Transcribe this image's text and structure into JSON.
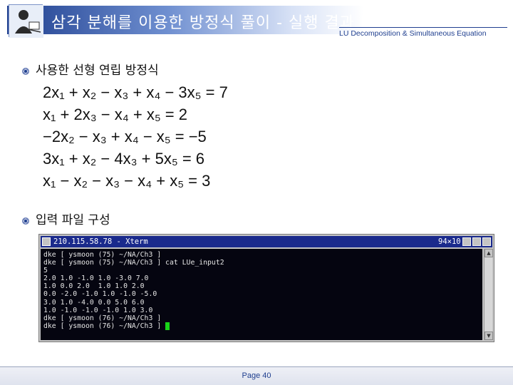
{
  "header": {
    "title": "삼각 분해를 이용한 방정식 풀이 - 실행 결과 II (1/2)",
    "subtitle": "LU Decomposition & Simultaneous Equation"
  },
  "bullets": [
    {
      "text": "사용한 선형 연립 방정식"
    },
    {
      "text": "입력 파일 구성"
    }
  ],
  "equations": [
    "2x₁ + x₂ − x₃ + x₄ − 3x₅ = 7",
    "x₁ + 2x₃ − x₄ + x₅ = 2",
    "−2x₂ − x₃ + x₄ − x₅ = −5",
    "3x₁ + x₂ − 4x₃ + 5x₅ = 6",
    "x₁ − x₂ − x₃ − x₄ + x₅ = 3"
  ],
  "terminal": {
    "title": "210.115.58.78 - Xterm",
    "size": "94×10",
    "lines": [
      "dke [ ysmoon (75) ~/NA/Ch3 ]",
      "dke [ ysmoon (75) ~/NA/Ch3 ] cat LUe_input2",
      "5",
      "2.0 1.0 -1.0 1.0 -3.0 7.0",
      "1.0 0.0 2.0  1.0 1.0 2.0",
      "0.0 -2.0 -1.0 1.0 -1.0 -5.0",
      "3.0 1.0 -4.0 0.0 5.0 6.0",
      "1.0 -1.0 -1.0 -1.0 1.0 3.0",
      "dke [ ysmoon (76) ~/NA/Ch3 ]",
      "dke [ ysmoon (76) ~/NA/Ch3 ] "
    ]
  },
  "footer": {
    "page": "Page 40"
  },
  "colors": {
    "accent": "#1f3f8f",
    "terminal_bg": "#050510",
    "cursor": "#19d419"
  }
}
